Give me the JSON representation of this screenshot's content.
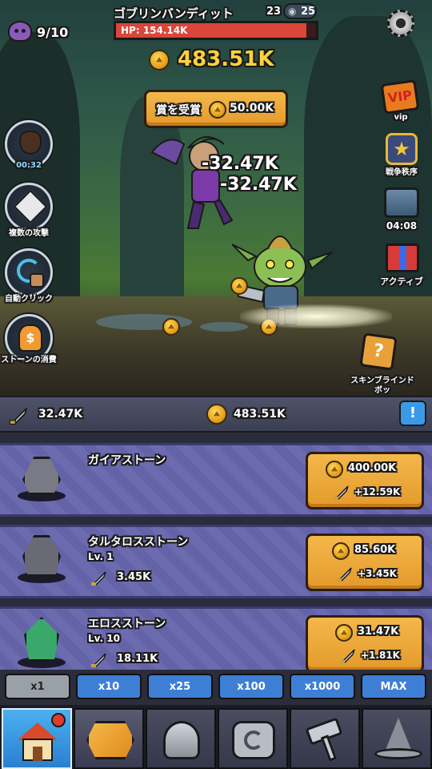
{
  "hud": {
    "wave_count": "9/10",
    "enemy_name": "ゴブリンバンディット",
    "stage_num": "23",
    "stage_total": "25",
    "hp_text": "HP: 154.14K",
    "hp_fraction": 0.95,
    "gold": "483.51K"
  },
  "reward_button": {
    "label": "賞を受賞",
    "value": "50.00K"
  },
  "damage_popups": [
    "-32.47K",
    "-32.47K"
  ],
  "left_skills": [
    {
      "label": "00:32",
      "icon": "money-bag-icon"
    },
    {
      "label": "複数の攻撃",
      "icon": "multi-attack-icon"
    },
    {
      "label": "自動クリック",
      "icon": "auto-click-icon"
    },
    {
      "label": "ストーンの消費",
      "icon": "stone-consume-icon"
    }
  ],
  "right_menu": [
    {
      "label": "vip",
      "icon": "vip-badge-icon"
    },
    {
      "label": "戦争秩序",
      "icon": "war-order-star-icon"
    },
    {
      "label": "04:08",
      "icon": "treasure-chest-icon"
    },
    {
      "label": "アクティブ",
      "icon": "gift-box-icon"
    },
    {
      "label": "スキンブラインドボッ",
      "icon": "skin-blind-box-icon"
    }
  ],
  "stats": {
    "damage": "32.47K",
    "gold": "483.51K",
    "info_label": "!"
  },
  "stones": [
    {
      "name": "ガイアストーン",
      "level": "",
      "damage": "",
      "cost": "400.00K",
      "gain": "+12.59K",
      "color": "#7a7a86",
      "icon": "gaia-stone-icon"
    },
    {
      "name": "タルタロスストーン",
      "level": "Lv. 1",
      "damage": "3.45K",
      "cost": "85.60K",
      "gain": "+3.45K",
      "color": "#6a6a74",
      "icon": "tartarus-stone-icon"
    },
    {
      "name": "エロスストーン",
      "level": "Lv. 10",
      "damage": "18.11K",
      "cost": "31.47K",
      "gain": "+1.81K",
      "color": "#3aa86a",
      "icon": "eros-stone-icon"
    }
  ],
  "multipliers": [
    "x1",
    "x10",
    "x25",
    "x100",
    "x1000",
    "MAX"
  ],
  "tabs": [
    "home-icon",
    "stone-icon",
    "helmet-icon",
    "rune-stone-icon",
    "hammer-icon",
    "wizard-hat-icon"
  ],
  "colors": {
    "hp_red": "#d9463a",
    "button_orange": "#f0a93a",
    "multiplier_blue": "#3e7fd6",
    "row_purple": "#6d6bb0"
  }
}
